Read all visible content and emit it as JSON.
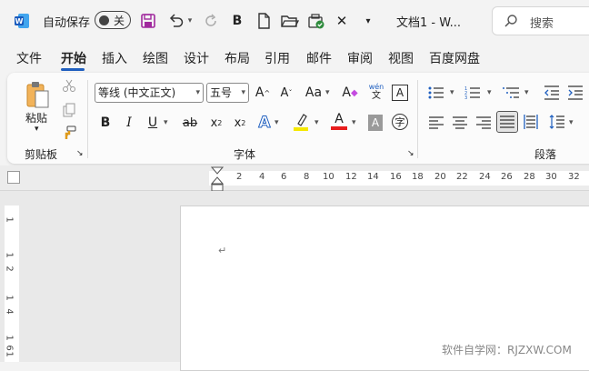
{
  "titlebar": {
    "autosave_label": "自动保存",
    "autosave_state": "关",
    "doc_title": "文档1  -  W...",
    "search_placeholder": "搜索",
    "quick_access": [
      "word-logo-icon",
      "save-icon",
      "undo-icon",
      "redo-icon",
      "bold-icon",
      "new-doc-icon",
      "open-folder-icon",
      "check-icon",
      "close-icon",
      "customize-icon"
    ]
  },
  "tabs": [
    "文件",
    "开始",
    "插入",
    "绘图",
    "设计",
    "布局",
    "引用",
    "邮件",
    "审阅",
    "视图",
    "百度网盘"
  ],
  "active_tab": "开始",
  "ribbon": {
    "clipboard": {
      "paste_label": "粘贴",
      "group_label": "剪贴板"
    },
    "font": {
      "font_name": "等线 (中文正文)",
      "font_size": "五号",
      "group_label": "字体",
      "phonetic": "wén",
      "phonetic_char": "文"
    },
    "paragraph": {
      "group_label": "段落"
    }
  },
  "ruler": {
    "top_numbers": [
      "2",
      "4",
      "6",
      "8",
      "10",
      "12",
      "14",
      "16",
      "18",
      "20",
      "22",
      "24",
      "26",
      "28",
      "30",
      "32"
    ],
    "left_numbers": [
      "1",
      "1",
      "2",
      "1",
      "4",
      "1",
      "6",
      "1"
    ]
  },
  "document": {
    "paragraph_mark": "↵"
  },
  "watermark": "软件自学网：RJZXW.COM",
  "colors": {
    "accent": "#1f5fbf",
    "font_color": "#e81c1c",
    "highlight": "#f5e800"
  }
}
